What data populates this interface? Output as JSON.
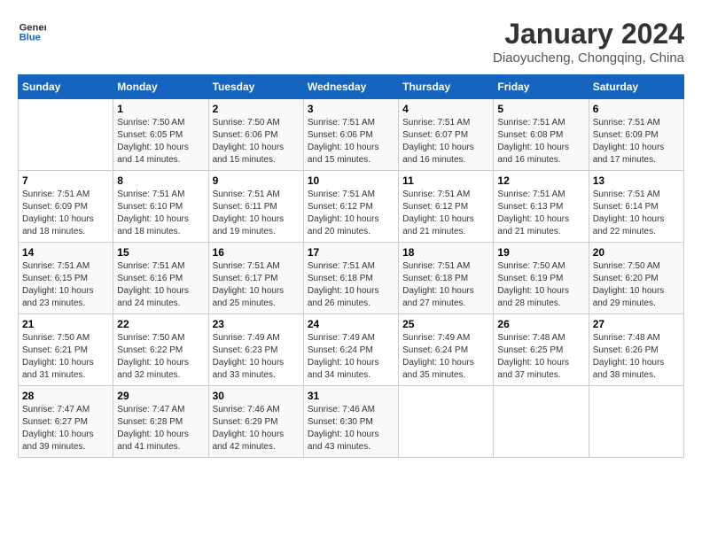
{
  "logo": {
    "line1": "General",
    "line2": "Blue"
  },
  "title": "January 2024",
  "subtitle": "Diaoyucheng, Chongqing, China",
  "headers": [
    "Sunday",
    "Monday",
    "Tuesday",
    "Wednesday",
    "Thursday",
    "Friday",
    "Saturday"
  ],
  "weeks": [
    [
      {
        "day": "",
        "info": ""
      },
      {
        "day": "1",
        "info": "Sunrise: 7:50 AM\nSunset: 6:05 PM\nDaylight: 10 hours\nand 14 minutes."
      },
      {
        "day": "2",
        "info": "Sunrise: 7:50 AM\nSunset: 6:06 PM\nDaylight: 10 hours\nand 15 minutes."
      },
      {
        "day": "3",
        "info": "Sunrise: 7:51 AM\nSunset: 6:06 PM\nDaylight: 10 hours\nand 15 minutes."
      },
      {
        "day": "4",
        "info": "Sunrise: 7:51 AM\nSunset: 6:07 PM\nDaylight: 10 hours\nand 16 minutes."
      },
      {
        "day": "5",
        "info": "Sunrise: 7:51 AM\nSunset: 6:08 PM\nDaylight: 10 hours\nand 16 minutes."
      },
      {
        "day": "6",
        "info": "Sunrise: 7:51 AM\nSunset: 6:09 PM\nDaylight: 10 hours\nand 17 minutes."
      }
    ],
    [
      {
        "day": "7",
        "info": "Sunrise: 7:51 AM\nSunset: 6:09 PM\nDaylight: 10 hours\nand 18 minutes."
      },
      {
        "day": "8",
        "info": "Sunrise: 7:51 AM\nSunset: 6:10 PM\nDaylight: 10 hours\nand 18 minutes."
      },
      {
        "day": "9",
        "info": "Sunrise: 7:51 AM\nSunset: 6:11 PM\nDaylight: 10 hours\nand 19 minutes."
      },
      {
        "day": "10",
        "info": "Sunrise: 7:51 AM\nSunset: 6:12 PM\nDaylight: 10 hours\nand 20 minutes."
      },
      {
        "day": "11",
        "info": "Sunrise: 7:51 AM\nSunset: 6:12 PM\nDaylight: 10 hours\nand 21 minutes."
      },
      {
        "day": "12",
        "info": "Sunrise: 7:51 AM\nSunset: 6:13 PM\nDaylight: 10 hours\nand 21 minutes."
      },
      {
        "day": "13",
        "info": "Sunrise: 7:51 AM\nSunset: 6:14 PM\nDaylight: 10 hours\nand 22 minutes."
      }
    ],
    [
      {
        "day": "14",
        "info": "Sunrise: 7:51 AM\nSunset: 6:15 PM\nDaylight: 10 hours\nand 23 minutes."
      },
      {
        "day": "15",
        "info": "Sunrise: 7:51 AM\nSunset: 6:16 PM\nDaylight: 10 hours\nand 24 minutes."
      },
      {
        "day": "16",
        "info": "Sunrise: 7:51 AM\nSunset: 6:17 PM\nDaylight: 10 hours\nand 25 minutes."
      },
      {
        "day": "17",
        "info": "Sunrise: 7:51 AM\nSunset: 6:18 PM\nDaylight: 10 hours\nand 26 minutes."
      },
      {
        "day": "18",
        "info": "Sunrise: 7:51 AM\nSunset: 6:18 PM\nDaylight: 10 hours\nand 27 minutes."
      },
      {
        "day": "19",
        "info": "Sunrise: 7:50 AM\nSunset: 6:19 PM\nDaylight: 10 hours\nand 28 minutes."
      },
      {
        "day": "20",
        "info": "Sunrise: 7:50 AM\nSunset: 6:20 PM\nDaylight: 10 hours\nand 29 minutes."
      }
    ],
    [
      {
        "day": "21",
        "info": "Sunrise: 7:50 AM\nSunset: 6:21 PM\nDaylight: 10 hours\nand 31 minutes."
      },
      {
        "day": "22",
        "info": "Sunrise: 7:50 AM\nSunset: 6:22 PM\nDaylight: 10 hours\nand 32 minutes."
      },
      {
        "day": "23",
        "info": "Sunrise: 7:49 AM\nSunset: 6:23 PM\nDaylight: 10 hours\nand 33 minutes."
      },
      {
        "day": "24",
        "info": "Sunrise: 7:49 AM\nSunset: 6:24 PM\nDaylight: 10 hours\nand 34 minutes."
      },
      {
        "day": "25",
        "info": "Sunrise: 7:49 AM\nSunset: 6:24 PM\nDaylight: 10 hours\nand 35 minutes."
      },
      {
        "day": "26",
        "info": "Sunrise: 7:48 AM\nSunset: 6:25 PM\nDaylight: 10 hours\nand 37 minutes."
      },
      {
        "day": "27",
        "info": "Sunrise: 7:48 AM\nSunset: 6:26 PM\nDaylight: 10 hours\nand 38 minutes."
      }
    ],
    [
      {
        "day": "28",
        "info": "Sunrise: 7:47 AM\nSunset: 6:27 PM\nDaylight: 10 hours\nand 39 minutes."
      },
      {
        "day": "29",
        "info": "Sunrise: 7:47 AM\nSunset: 6:28 PM\nDaylight: 10 hours\nand 41 minutes."
      },
      {
        "day": "30",
        "info": "Sunrise: 7:46 AM\nSunset: 6:29 PM\nDaylight: 10 hours\nand 42 minutes."
      },
      {
        "day": "31",
        "info": "Sunrise: 7:46 AM\nSunset: 6:30 PM\nDaylight: 10 hours\nand 43 minutes."
      },
      {
        "day": "",
        "info": ""
      },
      {
        "day": "",
        "info": ""
      },
      {
        "day": "",
        "info": ""
      }
    ]
  ]
}
